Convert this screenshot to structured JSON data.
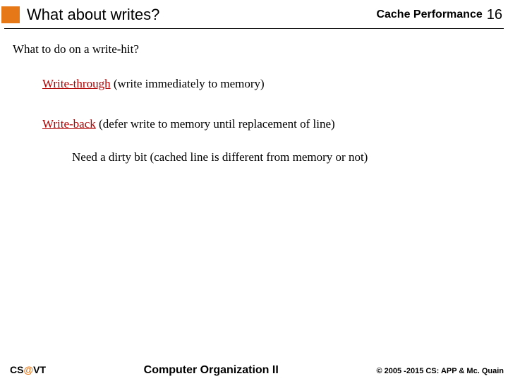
{
  "header": {
    "title": "What about writes?",
    "topic": "Cache Performance",
    "page": "16"
  },
  "body": {
    "question": "What to do on a write-hit?",
    "option1_term": "Write-through",
    "option1_desc": " (write immediately to memory)",
    "option2_term": "Write-back",
    "option2_desc": " (defer write to memory until replacement of line)",
    "sub": "Need a dirty bit (cached line is different from memory or not)"
  },
  "footer": {
    "org_prefix": "CS",
    "org_at": "@",
    "org_suffix": "VT",
    "center": "Computer Organization II",
    "right": "© 2005 -2015 CS: APP & Mc. Quain"
  }
}
